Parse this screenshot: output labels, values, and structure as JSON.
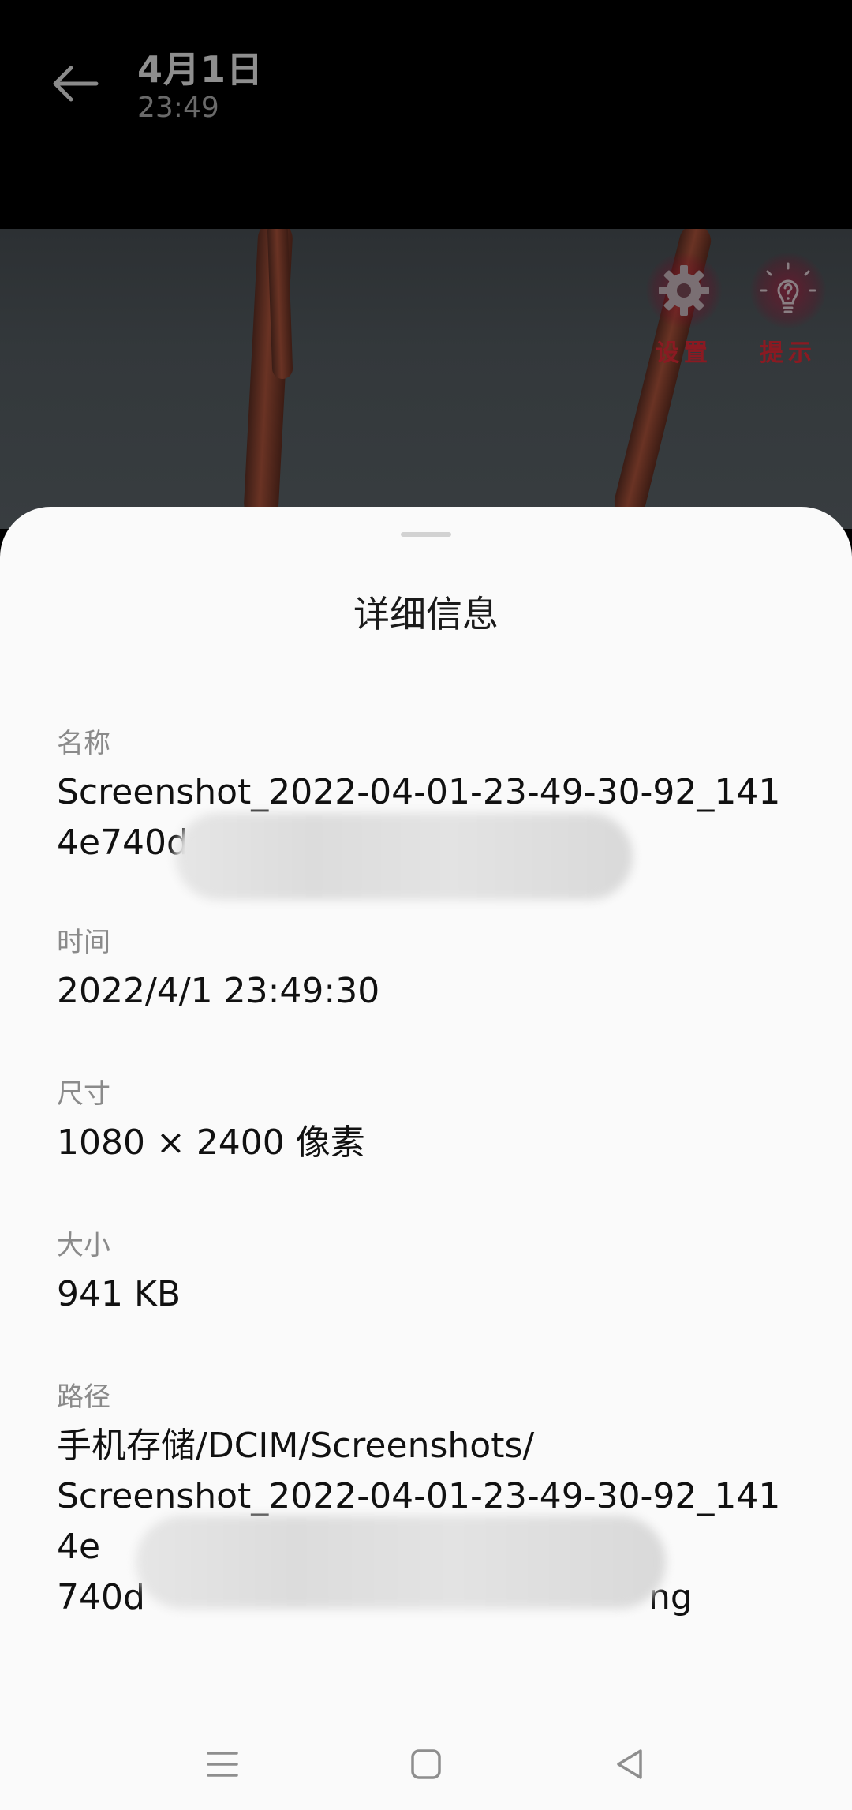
{
  "header": {
    "date": "4月1日",
    "time": "23:49"
  },
  "preview": {
    "settings_label": "设置",
    "hint_label": "提示"
  },
  "sheet": {
    "title": "详细信息",
    "name": {
      "label": "名称",
      "value": "Screenshot_2022-04-01-23-49-30-92_1414e740dc1"
    },
    "time": {
      "label": "时间",
      "value": "2022/4/1 23:49:30"
    },
    "size": {
      "label": "尺寸",
      "value": "1080 × 2400 像素"
    },
    "filesize": {
      "label": "大小",
      "value": "941 KB"
    },
    "path": {
      "label": "路径",
      "line1": "手机存储/DCIM/Screenshots/",
      "line2": "Screenshot_2022-04-01-23-49-30-92_1414e",
      "line3_start": "740d",
      "line3_end": "ng"
    }
  },
  "colors": {
    "sheet_bg": "#fafafa",
    "accent_red": "#8a1a22"
  },
  "icons": [
    "back-arrow-icon",
    "gear-icon",
    "lightbulb-icon",
    "menu-icon",
    "home-icon",
    "back-triangle-icon"
  ]
}
